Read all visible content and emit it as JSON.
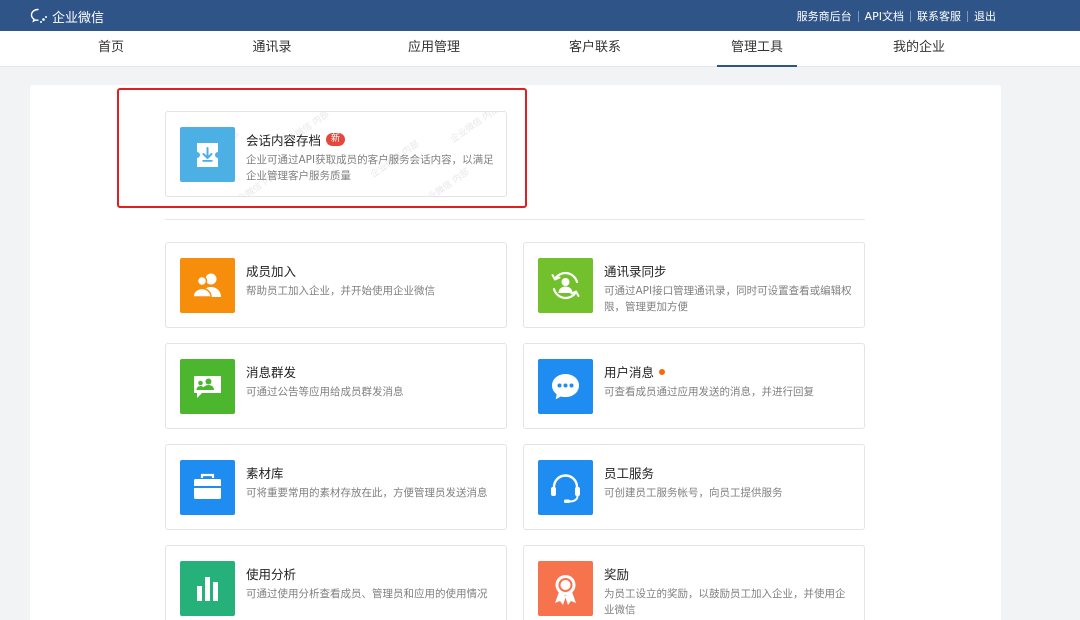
{
  "topbar": {
    "brand": "企业微信",
    "links": [
      "服务商后台",
      "API文档",
      "联系客服",
      "退出"
    ]
  },
  "nav": {
    "items": [
      "首页",
      "通讯录",
      "应用管理",
      "客户联系",
      "管理工具",
      "我的企业"
    ],
    "active": "管理工具"
  },
  "featured": {
    "title": "会话内容存档",
    "badge": "新",
    "desc": "企业可通过API获取成员的客户服务会话内容，以满足企业管理客户服务质量",
    "icon": "archive-download-icon",
    "color": "#4cb0e4"
  },
  "tools": [
    {
      "title": "成员加入",
      "desc": "帮助员工加入企业，并开始使用企业微信",
      "icon": "members-icon",
      "color": "#f78e0b"
    },
    {
      "title": "通讯录同步",
      "desc": "可通过API接口管理通讯录，同时可设置查看或编辑权限，管理更加方便",
      "icon": "contact-sync-icon",
      "color": "#72c02c"
    },
    {
      "title": "消息群发",
      "desc": "可通过公告等应用给成员群发消息",
      "icon": "broadcast-icon",
      "color": "#4cb62f"
    },
    {
      "title": "用户消息",
      "desc": "可查看成员通过应用发送的消息，并进行回复",
      "icon": "chat-bubble-icon",
      "color": "#1e8cf0",
      "dot": true
    },
    {
      "title": "素材库",
      "desc": "可将重要常用的素材存放在此，方便管理员发送消息",
      "icon": "briefcase-icon",
      "color": "#1e8cf0"
    },
    {
      "title": "员工服务",
      "desc": "可创建员工服务帐号，向员工提供服务",
      "icon": "headset-icon",
      "color": "#1e8cf0"
    },
    {
      "title": "使用分析",
      "desc": "可通过使用分析查看成员、管理员和应用的使用情况",
      "icon": "bar-analytics-icon",
      "color": "#26b07a"
    },
    {
      "title": "奖励",
      "desc": "为员工设立的奖励，以鼓励员工加入企业，并使用企业微信",
      "icon": "award-medal-icon",
      "color": "#f7734e"
    }
  ],
  "colors": {
    "topbar": "#2f5488",
    "highlight": "#e02020"
  }
}
